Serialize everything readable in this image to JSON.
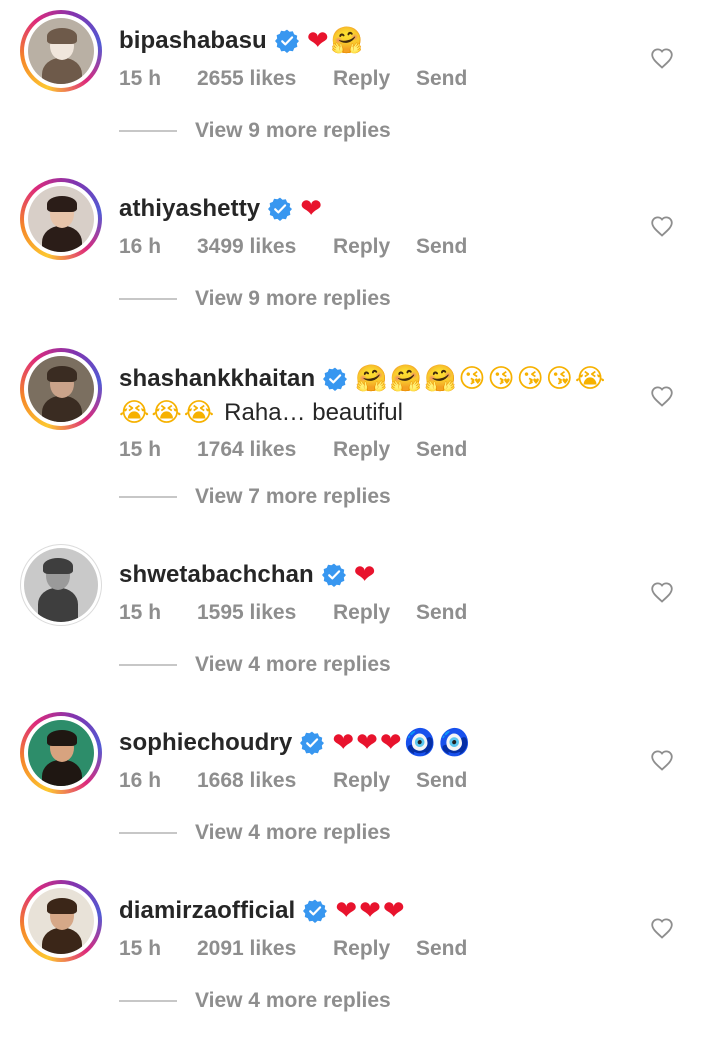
{
  "comments": [
    {
      "username": "bipashabasu",
      "emojis": [
        {
          "char": "❤",
          "cls": "heart",
          "icon": "red-heart-icon"
        },
        {
          "char": "🤗",
          "cls": "hug",
          "icon": "hugging-face-icon"
        }
      ],
      "second_line_emojis": [],
      "text": "",
      "time": "15 h",
      "likes": "2655 likes",
      "reply": "Reply",
      "send": "Send",
      "view_replies": "View 9 more replies"
    },
    {
      "username": "athiyashetty",
      "emojis": [
        {
          "char": "❤",
          "cls": "heart",
          "icon": "red-heart-icon"
        }
      ],
      "second_line_emojis": [],
      "text": "",
      "time": "16 h",
      "likes": "3499 likes",
      "reply": "Reply",
      "send": "Send",
      "view_replies": "View 9 more replies"
    },
    {
      "username": "shashankkhaitan",
      "emojis": [
        {
          "char": "🤗",
          "cls": "hug",
          "icon": "hugging-face-icon"
        },
        {
          "char": "🤗",
          "cls": "hug",
          "icon": "hugging-face-icon"
        },
        {
          "char": "🤗",
          "cls": "hug",
          "icon": "hugging-face-icon"
        },
        {
          "char": "😘",
          "cls": "kiss",
          "icon": "face-blowing-kiss-icon"
        },
        {
          "char": "😘",
          "cls": "kiss",
          "icon": "face-blowing-kiss-icon"
        },
        {
          "char": "😘",
          "cls": "kiss",
          "icon": "face-blowing-kiss-icon"
        },
        {
          "char": "😘",
          "cls": "kiss",
          "icon": "face-blowing-kiss-icon"
        },
        {
          "char": "😭",
          "cls": "cry",
          "icon": "loudly-crying-face-icon"
        }
      ],
      "second_line_emojis": [
        {
          "char": "😭",
          "cls": "cry",
          "icon": "loudly-crying-face-icon"
        },
        {
          "char": "😭",
          "cls": "cry",
          "icon": "loudly-crying-face-icon"
        },
        {
          "char": "😭",
          "cls": "cry",
          "icon": "loudly-crying-face-icon"
        }
      ],
      "text": "Raha… beautiful",
      "time": "15 h",
      "likes": "1764 likes",
      "reply": "Reply",
      "send": "Send",
      "view_replies": "View 7 more replies"
    },
    {
      "username": "shwetabachchan",
      "emojis": [
        {
          "char": "❤",
          "cls": "heart",
          "icon": "red-heart-icon"
        }
      ],
      "second_line_emojis": [],
      "text": "",
      "time": "15 h",
      "likes": "1595 likes",
      "reply": "Reply",
      "send": "Send",
      "view_replies": "View 4 more replies"
    },
    {
      "username": "sophiechoudry",
      "emojis": [
        {
          "char": "❤",
          "cls": "heart",
          "icon": "red-heart-icon"
        },
        {
          "char": "❤",
          "cls": "heart",
          "icon": "red-heart-icon"
        },
        {
          "char": "❤",
          "cls": "heart",
          "icon": "red-heart-icon"
        },
        {
          "char": "🧿",
          "cls": "eye",
          "icon": "nazar-amulet-icon"
        },
        {
          "char": "🧿",
          "cls": "eye",
          "icon": "nazar-amulet-icon"
        }
      ],
      "second_line_emojis": [],
      "text": "",
      "time": "16 h",
      "likes": "1668 likes",
      "reply": "Reply",
      "send": "Send",
      "view_replies": "View 4 more replies"
    },
    {
      "username": "diamirzaofficial",
      "emojis": [
        {
          "char": "❤",
          "cls": "heart",
          "icon": "red-heart-icon"
        },
        {
          "char": "❤",
          "cls": "heart",
          "icon": "red-heart-icon"
        },
        {
          "char": "❤",
          "cls": "heart",
          "icon": "red-heart-icon"
        }
      ],
      "second_line_emojis": [],
      "text": "",
      "time": "15 h",
      "likes": "2091 likes",
      "reply": "Reply",
      "send": "Send",
      "view_replies": "View 4 more replies"
    }
  ],
  "colors": {
    "text": "#262626",
    "meta": "#8e8e8e",
    "verified": "#3897f0",
    "heart": "#e8132d"
  }
}
